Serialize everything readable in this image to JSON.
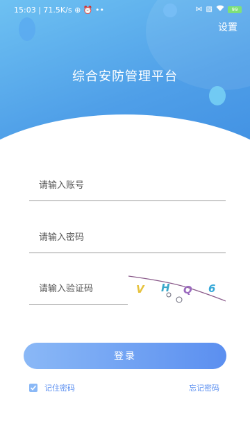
{
  "status_bar": {
    "time": "15:03",
    "speed": "71.5K/s",
    "battery": "99"
  },
  "header": {
    "settings_label": "设置",
    "title": "综合安防管理平台"
  },
  "form": {
    "account_placeholder": "请输入账号",
    "password_placeholder": "请输入密码",
    "captcha_placeholder": "请输入验证码",
    "captcha_chars": [
      "V",
      "H",
      "Q",
      "6"
    ]
  },
  "login_label": "登录",
  "remember": {
    "label": "记住密码",
    "checked": true
  },
  "forgot_label": "忘记密码",
  "colors": {
    "header_gradient_start": "#6ec1f2",
    "header_gradient_end": "#3f8ee2",
    "accent": "#5b8ff0"
  }
}
